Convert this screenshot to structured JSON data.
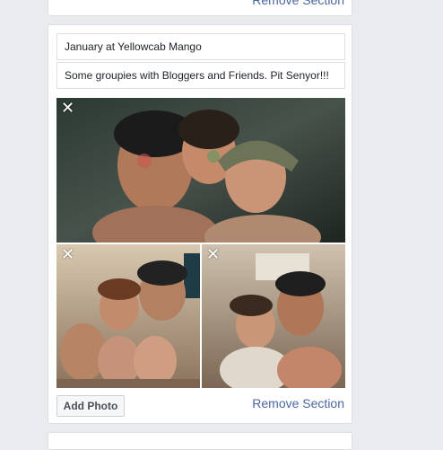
{
  "sections": [
    {
      "remove_label": "Remove Section"
    },
    {
      "title_value": "January at Yellowcab Mango",
      "description_value": "Some groupies with Bloggers and Friends. Pit Senyor!!!",
      "photos": [
        {
          "remove_glyph": "✕"
        },
        {
          "remove_glyph": "✕"
        },
        {
          "remove_glyph": "✕"
        }
      ],
      "add_photo_label": "Add Photo",
      "remove_label": "Remove Section"
    }
  ],
  "colors": {
    "link": "#4b67a1",
    "page_background": "#e9ebee",
    "card_border": "#dddfe2"
  }
}
